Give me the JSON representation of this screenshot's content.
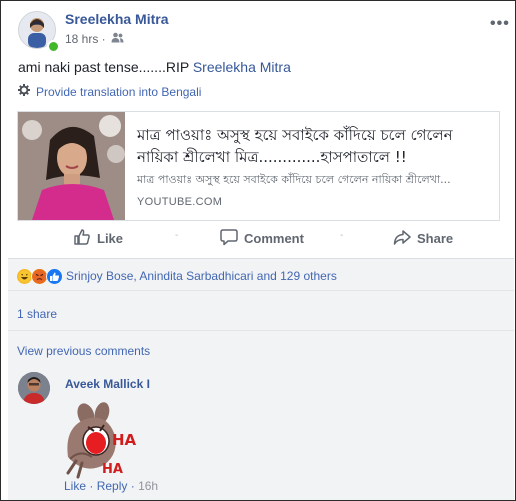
{
  "post": {
    "author": "Sreelekha Mitra",
    "time": "18 hrs ·",
    "more_label": "•••",
    "text_prefix": "ami naki past tense.......RIP ",
    "text_mention": "Sreelekha Mitra",
    "translate_label": "Provide translation into Bengali"
  },
  "link_card": {
    "title": "মাত্র পাওয়াঃ অসুস্থ হয়ে সবাইকে কাঁদিয়ে চলে গেলেন নায়িকা শ্রীলেখা মিত্র.............হাসপাতালে !!",
    "description": "মাত্র পাওয়াঃ অসুস্থ হয়ে সবাইকে কাঁদিয়ে চলে গেলেন নায়িকা শ্রীলেখা...",
    "domain": "YOUTUBE.COM"
  },
  "actions": {
    "like": "Like",
    "comment": "Comment",
    "share": "Share",
    "separator": "-"
  },
  "reactions": {
    "icons": [
      "haha-icon",
      "angry-icon",
      "like-icon"
    ],
    "names": "Srinjoy Bose, Anindita Sarbadhicari and 129 others"
  },
  "shares": "1 share",
  "comments": {
    "view_previous": "View previous comments",
    "items": [
      {
        "author": "Aveek Mallick I",
        "sticker_text": "HA HA",
        "like": "Like",
        "reply": "Reply",
        "separator": "·",
        "time": "16h"
      }
    ]
  },
  "colors": {
    "link": "#385898",
    "secondary_text": "#616770",
    "panel_bg": "#f2f3f5"
  }
}
